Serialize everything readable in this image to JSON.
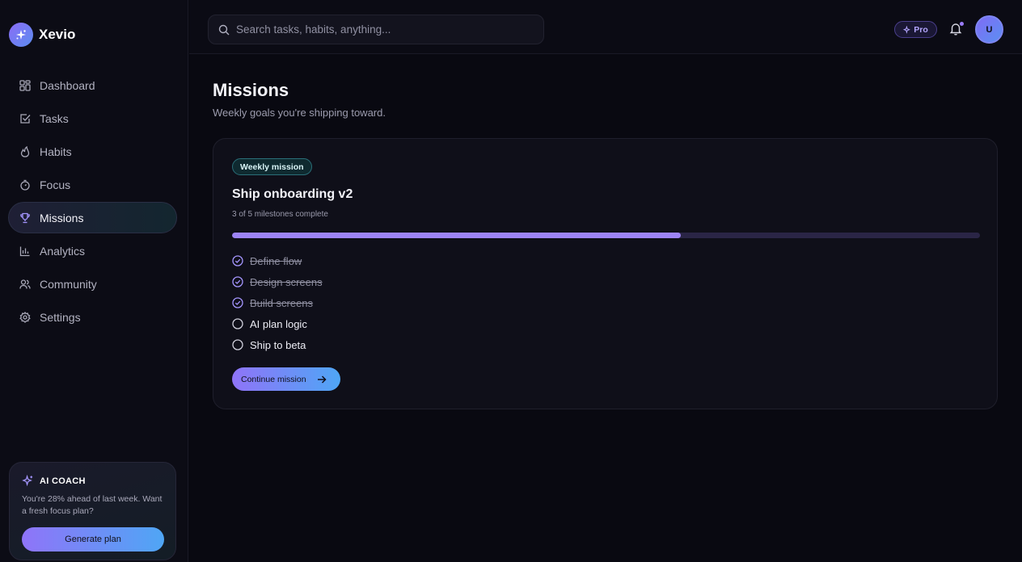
{
  "app": {
    "name": "Xevio"
  },
  "sidebar": {
    "items": [
      {
        "label": "Dashboard",
        "icon": "grid-icon"
      },
      {
        "label": "Tasks",
        "icon": "check-square-icon"
      },
      {
        "label": "Habits",
        "icon": "flame-icon"
      },
      {
        "label": "Focus",
        "icon": "timer-icon"
      },
      {
        "label": "Missions",
        "icon": "trophy-icon",
        "active": true
      },
      {
        "label": "Analytics",
        "icon": "bar-chart-icon"
      },
      {
        "label": "Community",
        "icon": "users-icon"
      },
      {
        "label": "Settings",
        "icon": "gear-icon"
      }
    ],
    "coach": {
      "title": "AI COACH",
      "text": "You're 28% ahead of last week. Want a fresh focus plan?",
      "button": "Generate plan"
    }
  },
  "topbar": {
    "search_placeholder": "Search tasks, habits, anything...",
    "pro_label": "Pro",
    "avatar_initial": "U"
  },
  "page": {
    "title": "Missions",
    "subtitle": "Weekly goals you're shipping toward."
  },
  "mission": {
    "badge": "Weekly mission",
    "title": "Ship onboarding v2",
    "progress_text": "3 of 5 milestones complete",
    "progress_fraction": 0.6,
    "milestones": [
      {
        "label": "Define flow",
        "done": true
      },
      {
        "label": "Design screens",
        "done": true
      },
      {
        "label": "Build screens",
        "done": true
      },
      {
        "label": "AI plan logic",
        "done": false
      },
      {
        "label": "Ship to beta",
        "done": false
      }
    ],
    "button": "Continue mission"
  },
  "colors": {
    "accent": "#9d84f6",
    "accent_gradient_end": "#4fa6f5",
    "background": "#090911",
    "badge_teal": "#2a6e78"
  }
}
